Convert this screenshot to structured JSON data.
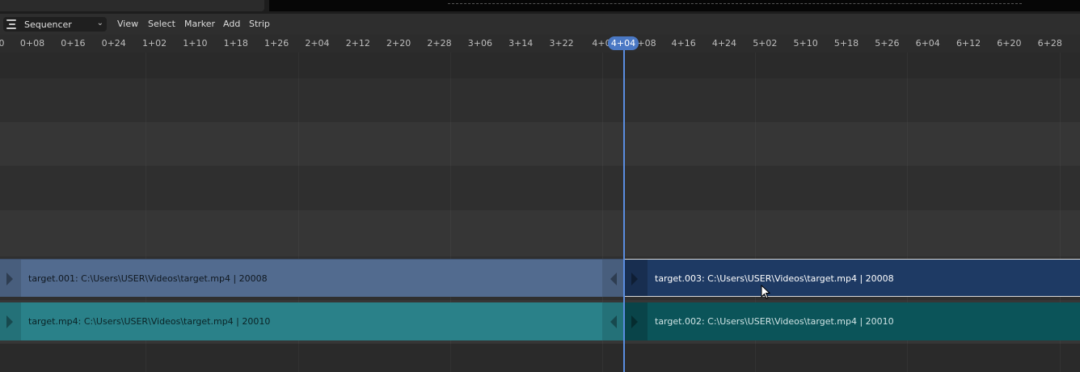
{
  "header": {
    "editor_type": "Sequencer",
    "menus": [
      "View",
      "Select",
      "Marker",
      "Add",
      "Strip"
    ]
  },
  "ruler": {
    "ticks": [
      "0",
      "0+08",
      "0+16",
      "0+24",
      "1+02",
      "1+10",
      "1+18",
      "1+26",
      "2+04",
      "2+12",
      "2+20",
      "2+28",
      "3+06",
      "3+14",
      "3+22",
      "4+0",
      "+08",
      "4+16",
      "4+24",
      "5+02",
      "5+10",
      "5+18",
      "5+26",
      "6+04",
      "6+12",
      "6+20",
      "6+28"
    ],
    "current_frame": "4+04"
  },
  "strips": [
    {
      "label": "target.001: C:\\Users\\USER\\Videos\\target.mp4 | 20008",
      "color": "#526b8f",
      "selected": false
    },
    {
      "label": "target.003: C:\\Users\\USER\\Videos\\target.mp4 | 20008",
      "color": "#1e3a64",
      "selected": true
    },
    {
      "label": "target.mp4: C:\\Users\\USER\\Videos\\target.mp4 | 20010",
      "color": "#2a8189",
      "selected": false
    },
    {
      "label": "target.002: C:\\Users\\USER\\Videos\\target.mp4 | 20010",
      "color": "#0b5459",
      "selected": false
    }
  ],
  "colors": {
    "playhead": "#5a8de0",
    "header_bg": "#2e2e2e",
    "channel_light": "#313131",
    "channel_dark": "#2a2a2a"
  }
}
